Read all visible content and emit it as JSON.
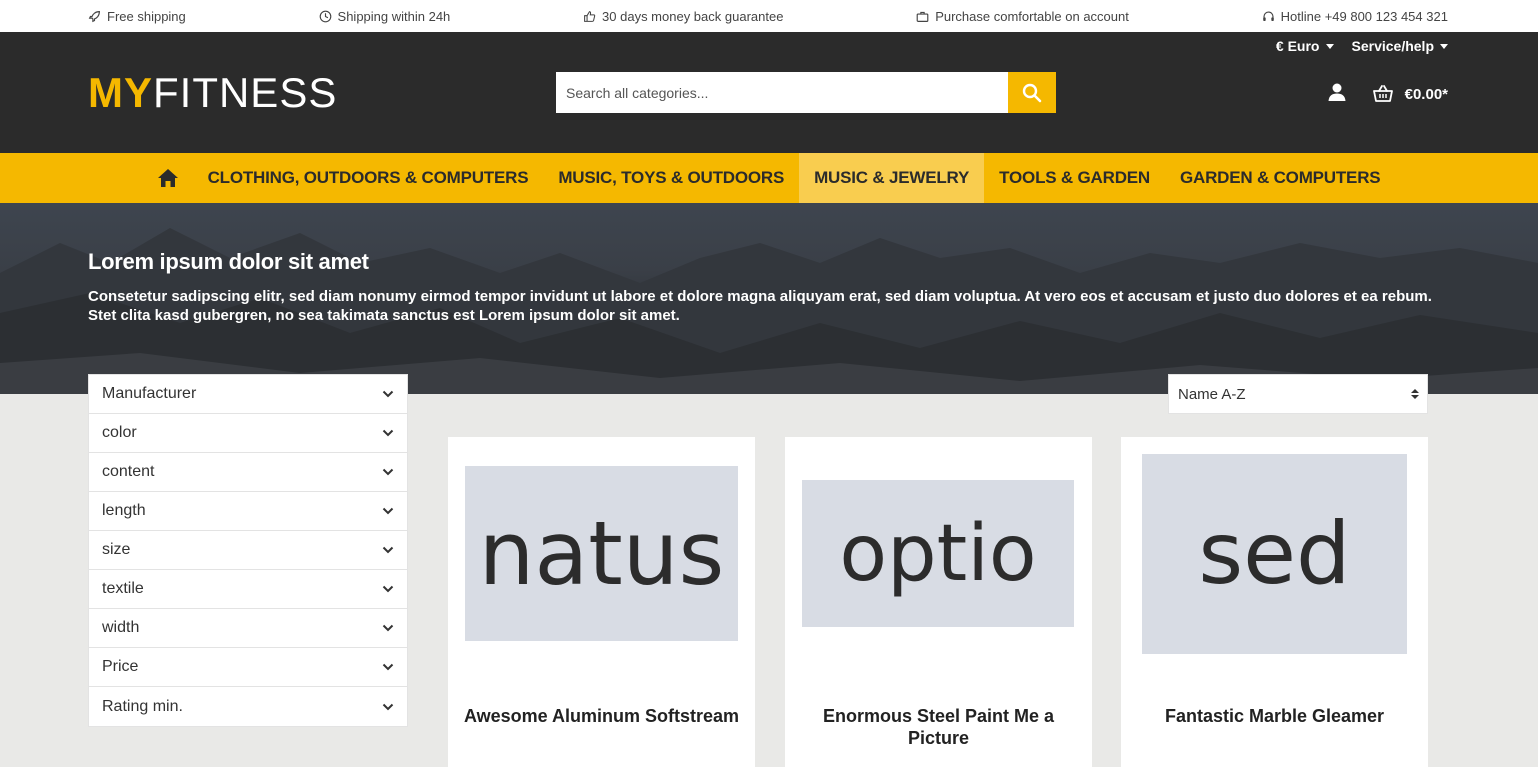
{
  "usp": {
    "shipping": "Free shipping",
    "delivery": "Shipping within 24h",
    "guarantee": "30 days money back guarantee",
    "account": "Purchase comfortable on account",
    "hotline": "Hotline +49 800 123 454 321"
  },
  "header": {
    "currency": "€ Euro",
    "service": "Service/help",
    "logo_accent": "MY",
    "logo_rest": "FITNESS",
    "search_placeholder": "Search all categories...",
    "cart_total": "€0.00*"
  },
  "nav": {
    "items": [
      {
        "label": "CLOTHING, OUTDOORS & COMPUTERS"
      },
      {
        "label": "MUSIC, TOYS & OUTDOORS"
      },
      {
        "label": "MUSIC & JEWELRY"
      },
      {
        "label": "TOOLS & GARDEN"
      },
      {
        "label": "GARDEN & COMPUTERS"
      }
    ]
  },
  "hero": {
    "title": "Lorem ipsum dolor sit amet",
    "text": "Consetetur sadipscing elitr, sed diam nonumy eirmod tempor invidunt ut labore et dolore magna aliquyam erat, sed diam voluptua. At vero eos et accusam et justo duo dolores et ea rebum. Stet clita kasd gubergren, no sea takimata sanctus est Lorem ipsum dolor sit amet."
  },
  "filters": [
    {
      "label": "Manufacturer"
    },
    {
      "label": "color"
    },
    {
      "label": "content"
    },
    {
      "label": "length"
    },
    {
      "label": "size"
    },
    {
      "label": "textile"
    },
    {
      "label": "width"
    },
    {
      "label": "Price"
    },
    {
      "label": "Rating min."
    }
  ],
  "sort": {
    "selected": "Name A-Z"
  },
  "products": [
    {
      "image_text": "natus",
      "name": "Awesome Aluminum Softstream"
    },
    {
      "image_text": "optio",
      "name": "Enormous Steel Paint Me a Picture"
    },
    {
      "image_text": "sed",
      "name": "Fantastic Marble Gleamer"
    }
  ],
  "colors": {
    "brand_yellow": "#f5b800",
    "header_dark": "#2b2b2b",
    "nav_active": "#f9cd4f",
    "placeholder_bg": "#d8dce4"
  }
}
